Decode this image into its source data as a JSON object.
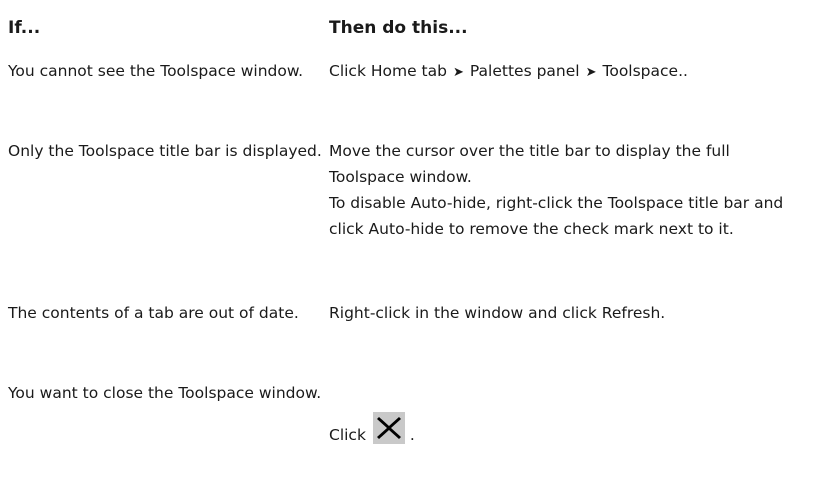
{
  "headers": {
    "if": "If...",
    "then": "Then do this..."
  },
  "rows": [
    {
      "if": "You cannot see the Toolspace window.",
      "then": {
        "part1": "Click Home tab",
        "part2": "Palettes panel",
        "part3": "Toolspace..",
        "arrow": "➤"
      }
    },
    {
      "if": "Only the Toolspace title bar is displayed.",
      "then": {
        "line1": "Move the cursor over the title bar to display the full Toolspace window.",
        "line2": "To disable Auto-hide, right-click the Toolspace title bar and click Auto-hide to remove the check mark next to it."
      }
    },
    {
      "if": "The contents of a tab are out of date.",
      "then": "Right-click in the window and click Refresh."
    },
    {
      "if": "You want to close the Toolspace window.",
      "then": {
        "prefix": "Click",
        "suffix": ".",
        "icon": "close-icon"
      }
    }
  ]
}
